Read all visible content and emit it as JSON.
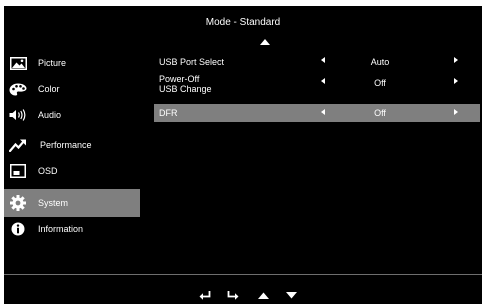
{
  "header": {
    "title": "Mode - Standard"
  },
  "sidebar": {
    "items": [
      {
        "label": "Picture",
        "icon": "picture-icon"
      },
      {
        "label": "Color",
        "icon": "palette-icon"
      },
      {
        "label": "Audio",
        "icon": "speaker-icon"
      },
      {
        "label": "Performance",
        "icon": "trend-icon"
      },
      {
        "label": "OSD",
        "icon": "osd-window-icon"
      },
      {
        "label": "System",
        "icon": "gear-icon",
        "selected": true
      },
      {
        "label": "Information",
        "icon": "info-icon"
      }
    ]
  },
  "settings": {
    "rows": [
      {
        "label": "USB Port Select",
        "value": "Auto"
      },
      {
        "label_line1": "Power-Off",
        "label_line2": "USB Change",
        "value": "Off"
      },
      {
        "label": "DFR",
        "value": "Off",
        "selected": true
      }
    ]
  },
  "footer": {
    "buttons": [
      "return-icon",
      "enter-icon",
      "up-arrow-icon",
      "down-arrow-icon"
    ]
  },
  "colors": {
    "background": "#000000",
    "highlight": "#7f7f7f",
    "text": "#ffffff"
  }
}
